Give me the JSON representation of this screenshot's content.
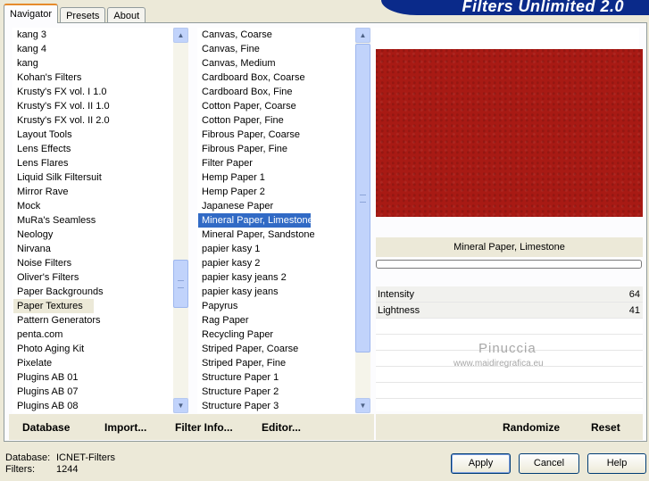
{
  "tabs": [
    {
      "label": "Navigator",
      "active": true
    },
    {
      "label": "Presets",
      "active": false
    },
    {
      "label": "About",
      "active": false
    }
  ],
  "banner": "Filters Unlimited 2.0",
  "navigator": {
    "items": [
      "kang 3",
      "kang 4",
      "kang",
      "Kohan's Filters",
      "Krusty's FX vol. I 1.0",
      "Krusty's FX vol. II 1.0",
      "Krusty's FX vol. II 2.0",
      "Layout Tools",
      "Lens Effects",
      "Lens Flares",
      "Liquid Silk Filtersuit",
      "Mirror Rave",
      "Mock",
      "MuRa's Seamless",
      "Neology",
      "Nirvana",
      "Noise Filters",
      "Oliver's Filters",
      "Paper Backgrounds",
      "Paper Textures",
      "Pattern Generators",
      "penta.com",
      "Photo Aging Kit",
      "Pixelate",
      "Plugins AB 01",
      "Plugins AB 07",
      "Plugins AB 08"
    ],
    "selected": "Paper Textures"
  },
  "filters": {
    "items": [
      "Canvas, Coarse",
      "Canvas, Fine",
      "Canvas, Medium",
      "Cardboard Box, Coarse",
      "Cardboard Box, Fine",
      "Cotton Paper, Coarse",
      "Cotton Paper, Fine",
      "Fibrous Paper, Coarse",
      "Fibrous Paper, Fine",
      "Filter Paper",
      "Hemp Paper 1",
      "Hemp Paper 2",
      "Japanese Paper",
      "Mineral Paper, Limestone",
      "Mineral Paper, Sandstone",
      "papier kasy 1",
      "papier kasy 2",
      "papier kasy jeans 2",
      "papier kasy jeans",
      "Papyrus",
      "Rag Paper",
      "Recycling Paper",
      "Striped Paper, Coarse",
      "Striped Paper, Fine",
      "Structure Paper 1",
      "Structure Paper 2",
      "Structure Paper 3"
    ],
    "selected": "Mineral Paper, Limestone"
  },
  "preview": {
    "filter_name": "Mineral Paper, Limestone",
    "color": "#a81a14"
  },
  "params": [
    {
      "name": "Intensity",
      "value": "64"
    },
    {
      "name": "Lightness",
      "value": "41"
    }
  ],
  "watermark": {
    "line1": "Pinuccia",
    "line2": "www.maidiregrafica.eu"
  },
  "bottom_links": {
    "database": "Database",
    "import": "Import...",
    "filter_info": "Filter Info...",
    "editor": "Editor...",
    "randomize": "Randomize",
    "reset": "Reset"
  },
  "status": {
    "db_label": "Database:",
    "db_value": "ICNET-Filters",
    "filters_label": "Filters:",
    "filters_value": "1244"
  },
  "buttons": {
    "apply": "Apply",
    "cancel": "Cancel",
    "help": "Help"
  }
}
